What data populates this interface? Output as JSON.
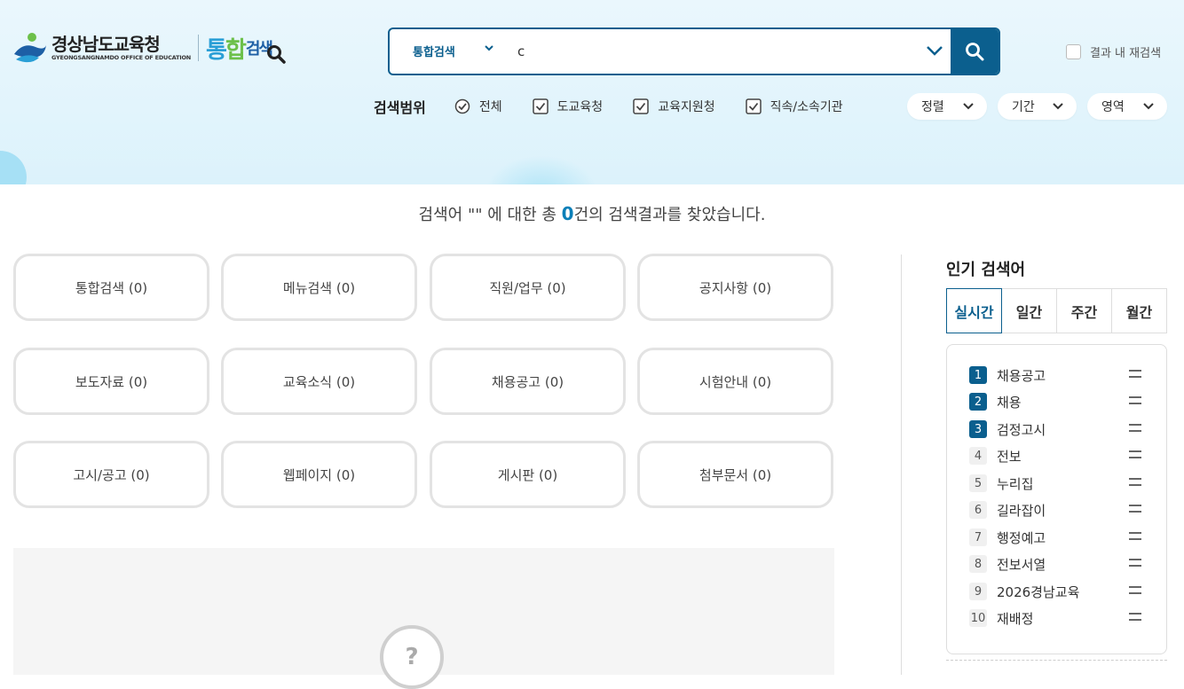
{
  "logo": {
    "org_ko": "경상남도교육청",
    "org_en": "GYEONGSANGNAMDO OFFICE OF EDUCATION",
    "brand_a": "통",
    "brand_b": "합",
    "brand_c": "검색"
  },
  "search": {
    "scope": "통합검색",
    "query": "c",
    "research_label": "결과 내 재검색"
  },
  "range": {
    "label": "검색범위",
    "options": [
      "전체",
      "도교육청",
      "교육지원청",
      "직속/소속기관"
    ]
  },
  "filters": [
    "정렬",
    "기간",
    "영역"
  ],
  "summary": {
    "prefix": "검색어 \"\" 에 대한 총 ",
    "count": "0",
    "suffix": "건의 검색결과를 찾았습니다."
  },
  "categories": [
    "통합검색 (0)",
    "메뉴검색 (0)",
    "직원/업무 (0)",
    "공지사항 (0)",
    "보도자료 (0)",
    "교육소식 (0)",
    "채용공고 (0)",
    "시험안내 (0)",
    "고시/공고 (0)",
    "웹페이지 (0)",
    "게시판 (0)",
    "첨부문서 (0)"
  ],
  "empty_icon": "?",
  "popular": {
    "title": "인기 검색어",
    "tabs": [
      "실시간",
      "일간",
      "주간",
      "월간"
    ],
    "items": [
      {
        "rank": "1",
        "term": "채용공고"
      },
      {
        "rank": "2",
        "term": "채용"
      },
      {
        "rank": "3",
        "term": "검정고시"
      },
      {
        "rank": "4",
        "term": "전보"
      },
      {
        "rank": "5",
        "term": "누리집"
      },
      {
        "rank": "6",
        "term": "길라잡이"
      },
      {
        "rank": "7",
        "term": "행정예고"
      },
      {
        "rank": "8",
        "term": "전보서열"
      },
      {
        "rank": "9",
        "term": "2026경남교육"
      },
      {
        "rank": "10",
        "term": "재배정"
      }
    ]
  },
  "colors": {
    "primary": "#0b5f8e",
    "accent": "#0b7fb8",
    "hero_bg": "#e3f4fc"
  },
  "icons": {
    "search_button": "search-icon",
    "scope_dropdown": "chevron-down-icon",
    "rank_change": "equal-icon"
  }
}
